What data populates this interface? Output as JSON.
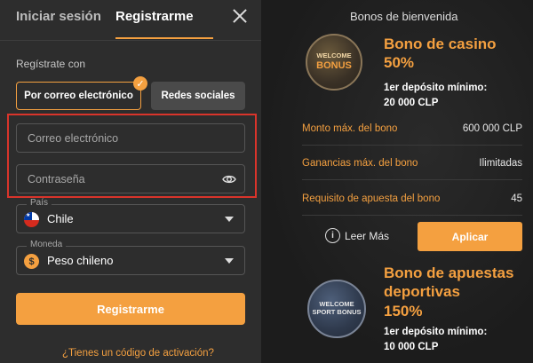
{
  "auth_tabs": {
    "login": "Iniciar sesión",
    "register": "Registrarme"
  },
  "form": {
    "register_with_label": "Regístrate con",
    "methods": {
      "email": "Por correo electrónico",
      "social": "Redes sociales"
    },
    "email_placeholder": "Correo electrónico",
    "password_placeholder": "Contraseña",
    "country": {
      "label": "País",
      "value": "Chile"
    },
    "currency": {
      "label": "Moneda",
      "value": "Peso chileno"
    },
    "submit": "Registrarme",
    "activation_link": "¿Tienes un código de activación?"
  },
  "bonuses": {
    "title": "Bonos de bienvenida",
    "casino": {
      "badge_line1": "WELCOME",
      "badge_line2": "BONUS",
      "title_line1": "Bono de casino",
      "title_line2": "50%",
      "deposit_label": "1er depósito mínimo:",
      "deposit_value": "20 000 CLP",
      "rows": [
        {
          "key": "Monto máx. del bono",
          "value": "600 000 CLP"
        },
        {
          "key": "Ganancias máx. del bono",
          "value": "Ilimitadas"
        },
        {
          "key": "Requisito de apuesta del bono",
          "value": "45"
        }
      ],
      "read_more": "Leer Más",
      "apply": "Aplicar"
    },
    "sport": {
      "badge_line1": "WELCOME",
      "badge_line2": "SPORT BONUS",
      "title_line1": "Bono de apuestas",
      "title_line2": "deportivas",
      "title_line3": "150%",
      "deposit_label": "1er depósito mínimo:",
      "deposit_value": "10 000 CLP"
    }
  },
  "colors": {
    "accent": "#f4a040",
    "highlight_box": "#d9342b"
  }
}
